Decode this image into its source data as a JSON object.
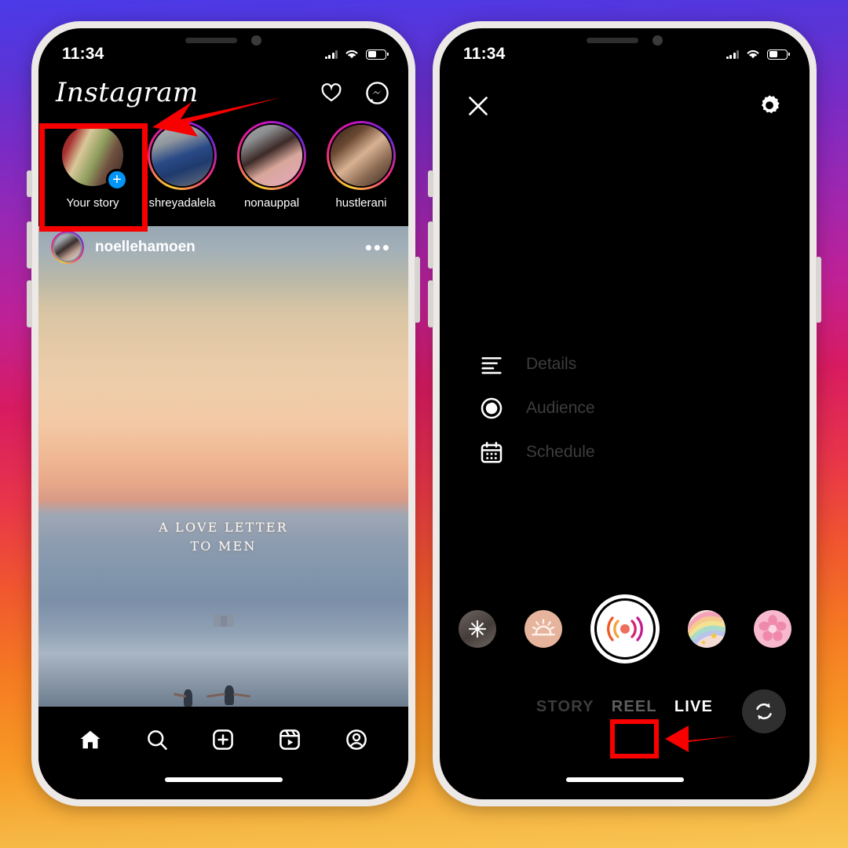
{
  "background": {
    "brand_gradient": [
      "#4a3ae8",
      "#9c27b0",
      "#d81b60",
      "#f0562f",
      "#f8c754"
    ]
  },
  "phones": {
    "left": {
      "name": "instagram-feed-screen",
      "status_bar": {
        "time": "11:34",
        "wifi_icon": "wifi-icon",
        "battery_icon": "battery-icon",
        "signal_icon": "signal-bars-icon"
      },
      "header": {
        "logo_text": "Instagram",
        "icons": [
          {
            "name": "heart-icon",
            "label": "Activity"
          },
          {
            "name": "messenger-icon",
            "label": "Messenger"
          }
        ]
      },
      "stories": [
        {
          "label": "Your story",
          "has_ring": false,
          "has_plus": true,
          "avatar": "av-you"
        },
        {
          "label": "shreyadalela",
          "has_ring": true,
          "has_plus": false,
          "avatar": "av-shrey"
        },
        {
          "label": "nonauppal",
          "has_ring": true,
          "has_plus": false,
          "avatar": "av-nona"
        },
        {
          "label": "hustlerani",
          "has_ring": true,
          "has_plus": false,
          "avatar": "av-hust"
        }
      ],
      "post": {
        "username": "noellehamoen",
        "more_options": "•••",
        "overlay_line1": "A LOVE LETTER",
        "overlay_line2": "TO MEN"
      },
      "bottom_nav": [
        {
          "name": "nav-home",
          "label": "Home",
          "active": true
        },
        {
          "name": "nav-search",
          "label": "Search",
          "active": false
        },
        {
          "name": "nav-create",
          "label": "Create",
          "active": false
        },
        {
          "name": "nav-reels",
          "label": "Reels",
          "active": false
        },
        {
          "name": "nav-profile",
          "label": "Profile",
          "active": false
        }
      ]
    },
    "right": {
      "name": "instagram-live-camera-screen",
      "status_bar": {
        "time": "11:34",
        "wifi_icon": "wifi-icon",
        "battery_icon": "battery-icon",
        "signal_icon": "signal-bars-icon"
      },
      "top_bar": {
        "close_label": "Close",
        "settings_label": "Settings"
      },
      "menu_items": [
        {
          "icon": "details-lines-icon",
          "label": "Details"
        },
        {
          "icon": "audience-icon",
          "label": "Audience"
        },
        {
          "icon": "calendar-icon",
          "label": "Schedule"
        }
      ],
      "filters": [
        {
          "name": "filter-thumbnail-1"
        },
        {
          "name": "filter-sunrise"
        },
        {
          "name": "filter-live-capture"
        },
        {
          "name": "filter-rainbow"
        },
        {
          "name": "filter-flower"
        }
      ],
      "capture_button_label": "Go Live",
      "modes": [
        {
          "label": "STORY",
          "active": false,
          "cut_off": true
        },
        {
          "label": "REEL",
          "active": false,
          "cut_off": false
        },
        {
          "label": "LIVE",
          "active": true,
          "cut_off": false
        }
      ],
      "flip_camera_label": "Flip camera"
    }
  },
  "annotations": {
    "highlight_color": "#f80000",
    "boxes": [
      {
        "name": "highlight-your-story",
        "target": "Your story"
      },
      {
        "name": "highlight-live-mode",
        "target": "LIVE"
      }
    ],
    "arrows": [
      {
        "name": "arrow-to-your-story",
        "direction": "left"
      },
      {
        "name": "arrow-to-live",
        "direction": "left"
      }
    ]
  }
}
